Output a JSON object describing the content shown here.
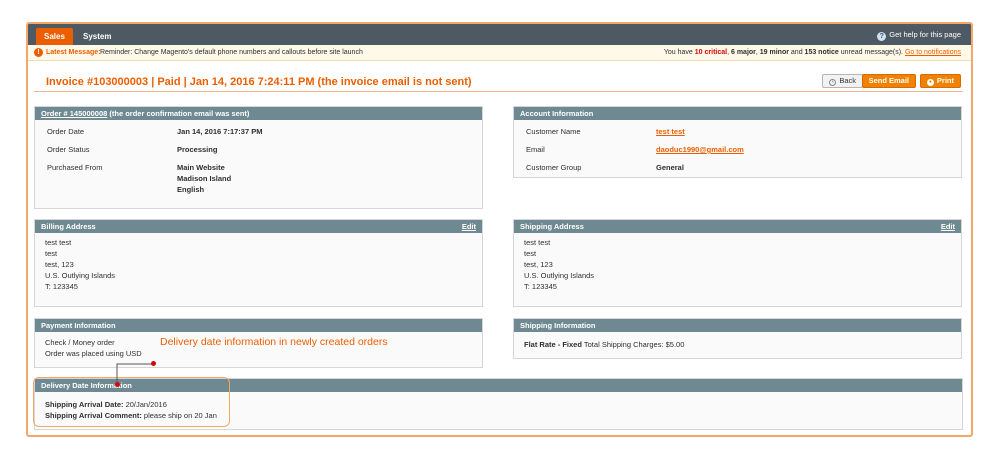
{
  "nav": {
    "tabs": [
      "Sales",
      "System"
    ],
    "help": "Get help for this page"
  },
  "notice": {
    "label": "Latest Message:",
    "message": "Reminder: Change Magento's default phone numbers and callouts before site launch",
    "summary_prefix": "You have",
    "critical": "10 critical",
    "major": "6 major",
    "minor": "19 minor",
    "notice_count": "153 notice",
    "summary_suffix": "unread message(s).",
    "link": "Go to notifications"
  },
  "page": {
    "title": "Invoice #103000003 | Paid | Jan 14, 2016 7:24:11 PM (the invoice email is not sent)",
    "back": "Back",
    "send_email": "Send Email",
    "print": "Print"
  },
  "order": {
    "head_link": "Order # 145000008",
    "head_rest": " (the order confirmation email was sent)",
    "date_label": "Order Date",
    "date": "Jan 14, 2016 7:17:37 PM",
    "status_label": "Order Status",
    "status": "Processing",
    "purchased_label": "Purchased From",
    "purchased": [
      "Main Website",
      "Madison Island",
      "English"
    ]
  },
  "account": {
    "head": "Account Information",
    "name_label": "Customer Name",
    "name": "test test",
    "email_label": "Email",
    "email": "daoduc1990@gmail.com",
    "group_label": "Customer Group",
    "group": "General"
  },
  "billing": {
    "head": "Billing Address",
    "edit": "Edit",
    "lines": [
      "test test",
      "test",
      "test, 123",
      "U.S. Outlying Islands",
      "T: 123345"
    ]
  },
  "shipping_address": {
    "head": "Shipping Address",
    "edit": "Edit",
    "lines": [
      "test test",
      "test",
      "test, 123",
      "U.S. Outlying Islands",
      "T: 123345"
    ]
  },
  "payment": {
    "head": "Payment Information",
    "lines": [
      "Check / Money order",
      "Order was placed using USD"
    ]
  },
  "shipping_info": {
    "head": "Shipping Information",
    "method": "Flat Rate - Fixed",
    "charges": "Total Shipping Charges: $5.00"
  },
  "delivery": {
    "head": "Delivery Date Information",
    "date_label": "Shipping Arrival Date:",
    "date": "20/Jan/2016",
    "comment_label": "Shipping Arrival Comment:",
    "comment": "please ship on 20 Jan"
  },
  "annotation": "Delivery date information in newly created orders",
  "colors": {
    "accent": "#eb5e00",
    "header_bar": "#6f8992",
    "nav": "#4d5963",
    "critical": "#d40707"
  }
}
